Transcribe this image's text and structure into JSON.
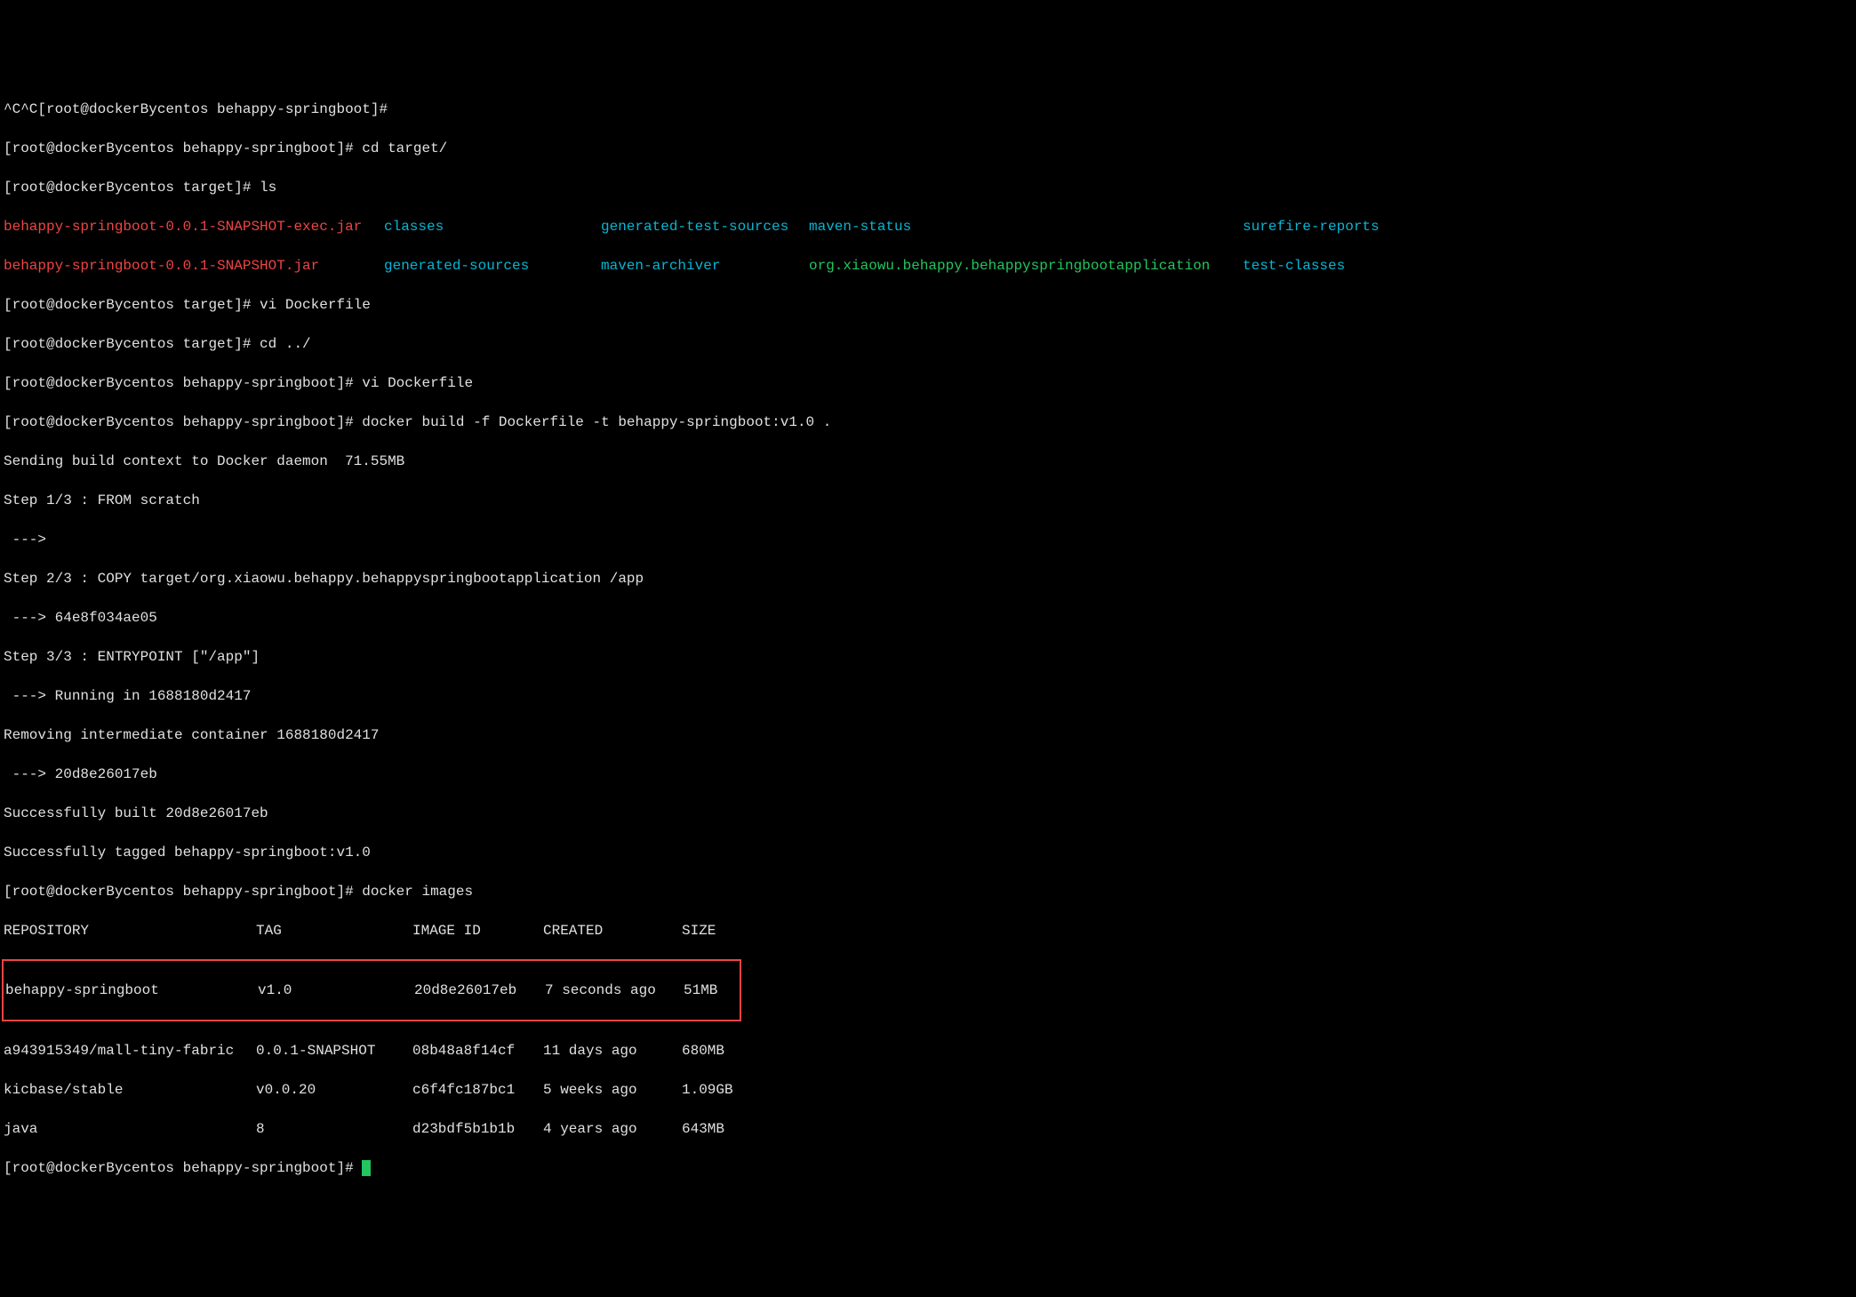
{
  "lines": {
    "l0": "^C^C[root@dockerBycentos behappy-springboot]#",
    "l1_prompt": "[root@dockerBycentos behappy-springboot]# ",
    "l1_cmd": "cd target/",
    "l2_prompt": "[root@dockerBycentos target]# ",
    "l2_cmd": "ls"
  },
  "ls": {
    "r1c1": "behappy-springboot-0.0.1-SNAPSHOT-exec.jar",
    "r1c2": "classes",
    "r1c3": "generated-test-sources",
    "r1c4": "maven-status",
    "r1c5": "surefire-reports",
    "r2c1": "behappy-springboot-0.0.1-SNAPSHOT.jar",
    "r2c2": "generated-sources",
    "r2c3": "maven-archiver",
    "r2c4": "org.xiaowu.behappy.behappyspringbootapplication",
    "r2c5": "test-classes"
  },
  "cmds": {
    "l3_prompt": "[root@dockerBycentos target]# ",
    "l3_cmd": "vi Dockerfile",
    "l4_prompt": "[root@dockerBycentos target]# ",
    "l4_cmd": "cd ../",
    "l5_prompt": "[root@dockerBycentos behappy-springboot]# ",
    "l5_cmd": "vi Dockerfile",
    "l6_prompt": "[root@dockerBycentos behappy-springboot]# ",
    "l6_cmd": "docker build -f Dockerfile -t behappy-springboot:v1.0 ."
  },
  "build": {
    "b1": "Sending build context to Docker daemon  71.55MB",
    "b2": "Step 1/3 : FROM scratch",
    "b3": " ---> ",
    "b4": "Step 2/3 : COPY target/org.xiaowu.behappy.behappyspringbootapplication /app",
    "b5": " ---> 64e8f034ae05",
    "b6": "Step 3/3 : ENTRYPOINT [\"/app\"]",
    "b7": " ---> Running in 1688180d2417",
    "b8": "Removing intermediate container 1688180d2417",
    "b9": " ---> 20d8e26017eb",
    "b10": "Successfully built 20d8e26017eb",
    "b11": "Successfully tagged behappy-springboot:v1.0"
  },
  "images_cmd": {
    "prompt": "[root@dockerBycentos behappy-springboot]# ",
    "cmd": "docker images"
  },
  "table": {
    "header": {
      "c1": "REPOSITORY",
      "c2": "TAG",
      "c3": "IMAGE ID",
      "c4": "CREATED",
      "c5": "SIZE"
    },
    "r1": {
      "c1": "behappy-springboot",
      "c2": "v1.0",
      "c3": "20d8e26017eb",
      "c4": "7 seconds ago",
      "c5": "51MB"
    },
    "r2": {
      "c1": "a943915349/mall-tiny-fabric",
      "c2": "0.0.1-SNAPSHOT",
      "c3": "08b48a8f14cf",
      "c4": "11 days ago",
      "c5": "680MB"
    },
    "r3": {
      "c1": "kicbase/stable",
      "c2": "v0.0.20",
      "c3": "c6f4fc187bc1",
      "c4": "5 weeks ago",
      "c5": "1.09GB"
    },
    "r4": {
      "c1": "java",
      "c2": "8",
      "c3": "d23bdf5b1b1b",
      "c4": "4 years ago",
      "c5": "643MB"
    }
  },
  "final_prompt": "[root@dockerBycentos behappy-springboot]# "
}
